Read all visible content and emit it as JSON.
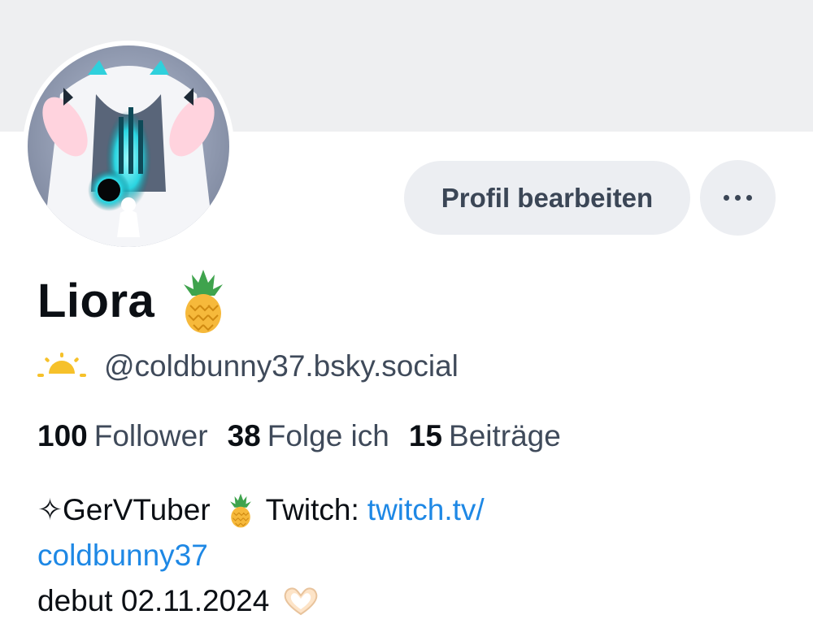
{
  "profile": {
    "display_name": "Liora",
    "handle": "@coldbunny37.bsky.social",
    "handle_prefix_icon": "sunrise-icon",
    "name_emoji": "pineapple-icon"
  },
  "actions": {
    "edit_label": "Profil bearbeiten",
    "more_icon": "ellipsis-icon"
  },
  "stats": [
    {
      "value": "100",
      "label": "Follower"
    },
    {
      "value": "38",
      "label": "Folge ich"
    },
    {
      "value": "15",
      "label": "Beiträge"
    }
  ],
  "bio": {
    "star_glyph": "✧",
    "tag": "GerVTuber",
    "twitch_prefix": "Twitch:",
    "link_part1": "twitch.tv/",
    "link_part2": "coldbunny37",
    "debut": "debut 02.11.2024",
    "debut_emoji": "heart-hands-icon"
  },
  "colors": {
    "accent_link": "#1e88e5",
    "banner": "#eeeff1",
    "button_bg": "#eceef2",
    "button_text": "#3b4656"
  }
}
